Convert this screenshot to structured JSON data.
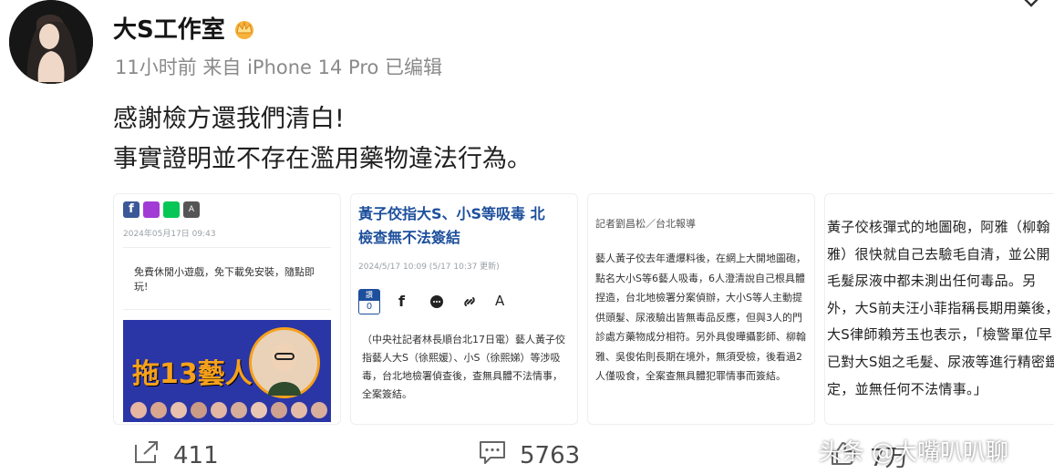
{
  "post": {
    "author": "大S工作室",
    "meta": "11小时前 来自 iPhone 14 Pro 已编辑",
    "text_line1": "感謝檢方還我們清白!",
    "text_line2": "事實證明並不存在濫用藥物違法行為。"
  },
  "thumb1": {
    "date": "2024年05月17日 09:43",
    "ad_text": "免費休閒小遊戲，免下載免安裝，隨點即玩!",
    "overlay_text": "拖13藝人"
  },
  "thumb2": {
    "headline1": "黃子佼指大S、小S等吸毒 北",
    "headline2": "檢查無不法簽結",
    "timestamp": "2024/5/17 10:09 (5/17 10:37 更新)",
    "like_label": "讚",
    "like_count": "0",
    "aa_label": "A",
    "body": "（中央社記者林長順台北17日電）藝人黃子佼指藝人大S（徐熙媛）、小S（徐熙娣）等涉吸毒，台北地檢署偵查後，查無具體不法情事，全案簽結。"
  },
  "thumb3": {
    "reporter": "記者劉昌松／台北報導",
    "body": "藝人黃子佼去年遭爆料後，在網上大開地圖砲，點名大小S等6藝人吸毒，6人澄清說自己根具體捏造，台北地檢署分案偵辦，大小S等人主動提供頭髮、尿液驗出皆無毒品反應，但與3人的門診處方藥物成分相符。另外具俊曄攝影師、柳翰雅、吳俊佑則長期在境外，無須受檢，後看過2人僅吸食，全案查無具體犯罪情事而簽結。"
  },
  "thumb4": {
    "body": "黃子佼核彈式的地圖砲，阿雅（柳翰雅）很快就自己去驗毛自清，並公開毛髮尿液中都未測出任何毒品。另外，大S前夫汪小菲指稱長期用藥後，大S律師賴芳玉也表示，「檢警單位早已對大S姐之毛髮、尿液等進行精密鑑定，並無任何不法情事。」"
  },
  "actions": {
    "share_count": "411",
    "comment_count": "5763",
    "like_count": "7万"
  },
  "watermark": "头条 @大嘴叭叭聊",
  "colors": {
    "facebook": "#3b5998",
    "messenger": "#a23bd6",
    "line": "#06c755",
    "headline_blue": "#1d4f9c",
    "overlay_orange": "#f6a11b"
  }
}
